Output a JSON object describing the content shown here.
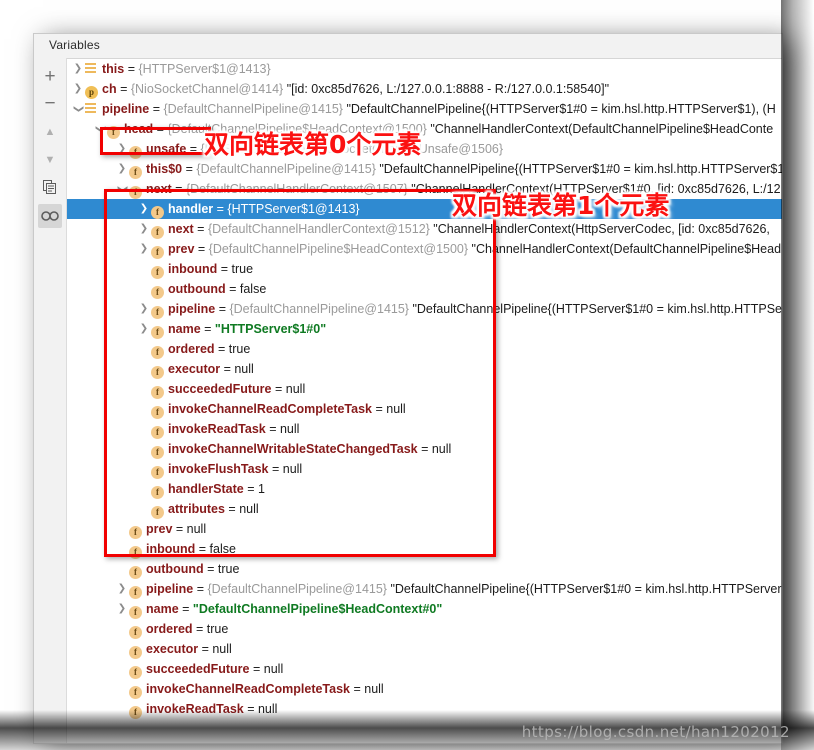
{
  "window": {
    "tool_window_title": "Variables"
  },
  "toolbar": {
    "buttons": [
      {
        "name": "add-watch-button",
        "icon": "plus-icon",
        "glyph": "+"
      },
      {
        "name": "remove-watch-button",
        "icon": "minus-icon",
        "glyph": "−"
      },
      {
        "name": "move-up-button",
        "icon": "arrow-up-icon",
        "glyph": "▲"
      },
      {
        "name": "move-down-button",
        "icon": "arrow-down-icon",
        "glyph": "▼"
      },
      {
        "name": "copy-value-button",
        "icon": "copy-icon",
        "glyph": "❐"
      },
      {
        "name": "toggle-watches-button",
        "icon": "glasses-icon",
        "glyph": "∞"
      }
    ]
  },
  "colors": {
    "selection_blue": "#2f8ad1",
    "annotation_red": "#f10000",
    "field_name": "#871a1a",
    "reference_gray": "#9a9a9a",
    "string_green": "#0f7a22",
    "panel_bg": "#ffffff",
    "header_bg": "#f2f2f2"
  },
  "annotations": [
    {
      "name": "annotation-head-element",
      "text": "双向链表第0个元素",
      "box_label": "head ="
    },
    {
      "name": "annotation-first-element",
      "text": "双向链表第1个元素",
      "box_label": "next context subtree"
    }
  ],
  "watermark": "https://blog.csdn.net/han1202012",
  "tree": {
    "rows": [
      {
        "indent": 0,
        "chev": "right",
        "icon": "bars",
        "name": "this",
        "eq": " = ",
        "ref": "{HTTPServer$1@1413}",
        "str": "",
        "selected": false
      },
      {
        "indent": 0,
        "chev": "right",
        "icon": "p",
        "name": "ch",
        "eq": " = ",
        "ref": "{NioSocketChannel@1414}",
        "str": "\"[id: 0xc85d7626, L:/127.0.0.1:8888 - R:/127.0.0.1:58540]\"",
        "selected": false
      },
      {
        "indent": 0,
        "chev": "down",
        "icon": "bars",
        "name": "pipeline",
        "eq": " = ",
        "ref": "{DefaultChannelPipeline@1415}",
        "str": "\"DefaultChannelPipeline{(HTTPServer$1#0 = kim.hsl.http.HTTPServer$1), (H",
        "selected": false
      },
      {
        "indent": 1,
        "chev": "down",
        "icon": "f",
        "name": "head",
        "eq": " = ",
        "ref": "{DefaultChannelPipeline$HeadContext@1500}",
        "str": "\"ChannelHandlerContext(DefaultChannelPipeline$HeadConte",
        "selected": false
      },
      {
        "indent": 2,
        "chev": "right",
        "icon": "f",
        "name": "unsafe",
        "eq": " = ",
        "ref": "{NioSocketChannel$NioSocketChannelUnsafe@1506}",
        "str": "",
        "selected": false
      },
      {
        "indent": 2,
        "chev": "right",
        "icon": "f",
        "name": "this$0",
        "eq": " = ",
        "ref": "{DefaultChannelPipeline@1415}",
        "str": "\"DefaultChannelPipeline{(HTTPServer$1#0 = kim.hsl.http.HTTPServer$1",
        "selected": false
      },
      {
        "indent": 2,
        "chev": "down",
        "icon": "f",
        "name": "next",
        "eq": " = ",
        "ref": "{DefaultChannelHandlerContext@1507}",
        "str": "\"ChannelHandlerContext(HTTPServer$1#0, [id: 0xc85d7626, L:/12",
        "selected": false
      },
      {
        "indent": 3,
        "chev": "right",
        "icon": "f",
        "name": "handler",
        "eq": " = ",
        "ref": "{HTTPServer$1@1413}",
        "str": "",
        "selected": true
      },
      {
        "indent": 3,
        "chev": "right",
        "icon": "f",
        "name": "next",
        "eq": " = ",
        "ref": "{DefaultChannelHandlerContext@1512}",
        "str": "\"ChannelHandlerContext(HttpServerCodec, [id: 0xc85d7626,",
        "selected": false
      },
      {
        "indent": 3,
        "chev": "right",
        "icon": "f",
        "name": "prev",
        "eq": " = ",
        "ref": "{DefaultChannelPipeline$HeadContext@1500}",
        "str": "\"ChannelHandlerContext(DefaultChannelPipeline$Head",
        "selected": false
      },
      {
        "indent": 3,
        "chev": "none",
        "icon": "f",
        "name": "inbound",
        "eq": " = ",
        "ref": "",
        "val": "true",
        "str": "",
        "selected": false
      },
      {
        "indent": 3,
        "chev": "none",
        "icon": "f",
        "name": "outbound",
        "eq": " = ",
        "ref": "",
        "val": "false",
        "str": "",
        "selected": false
      },
      {
        "indent": 3,
        "chev": "right",
        "icon": "f",
        "name": "pipeline",
        "eq": " = ",
        "ref": "{DefaultChannelPipeline@1415}",
        "str": "\"DefaultChannelPipeline{(HTTPServer$1#0 = kim.hsl.http.HTTPSe",
        "selected": false
      },
      {
        "indent": 3,
        "chev": "right",
        "icon": "f",
        "name": "name",
        "eq": " = ",
        "ref": "",
        "strv": "\"HTTPServer$1#0\"",
        "str": "",
        "selected": false
      },
      {
        "indent": 3,
        "chev": "none",
        "icon": "f",
        "name": "ordered",
        "eq": " = ",
        "ref": "",
        "val": "true",
        "str": "",
        "selected": false
      },
      {
        "indent": 3,
        "chev": "none",
        "icon": "f",
        "name": "executor",
        "eq": " = ",
        "ref": "",
        "val": "null",
        "str": "",
        "selected": false
      },
      {
        "indent": 3,
        "chev": "none",
        "icon": "f",
        "name": "succeededFuture",
        "eq": " = ",
        "ref": "",
        "val": "null",
        "str": "",
        "selected": false
      },
      {
        "indent": 3,
        "chev": "none",
        "icon": "f",
        "name": "invokeChannelReadCompleteTask",
        "eq": " = ",
        "ref": "",
        "val": "null",
        "str": "",
        "selected": false
      },
      {
        "indent": 3,
        "chev": "none",
        "icon": "f",
        "name": "invokeReadTask",
        "eq": " = ",
        "ref": "",
        "val": "null",
        "str": "",
        "selected": false
      },
      {
        "indent": 3,
        "chev": "none",
        "icon": "f",
        "name": "invokeChannelWritableStateChangedTask",
        "eq": " = ",
        "ref": "",
        "val": "null",
        "str": "",
        "selected": false
      },
      {
        "indent": 3,
        "chev": "none",
        "icon": "f",
        "name": "invokeFlushTask",
        "eq": " = ",
        "ref": "",
        "val": "null",
        "str": "",
        "selected": false
      },
      {
        "indent": 3,
        "chev": "none",
        "icon": "f",
        "name": "handlerState",
        "eq": " = ",
        "ref": "",
        "val": "1",
        "str": "",
        "selected": false
      },
      {
        "indent": 3,
        "chev": "none",
        "icon": "f",
        "name": "attributes",
        "eq": " = ",
        "ref": "",
        "val": "null",
        "str": "",
        "selected": false
      },
      {
        "indent": 2,
        "chev": "none",
        "icon": "f",
        "name": "prev",
        "eq": " = ",
        "ref": "",
        "val": "null",
        "str": "",
        "selected": false
      },
      {
        "indent": 2,
        "chev": "none",
        "icon": "f",
        "name": "inbound",
        "eq": " = ",
        "ref": "",
        "val": "false",
        "str": "",
        "selected": false
      },
      {
        "indent": 2,
        "chev": "none",
        "icon": "f",
        "name": "outbound",
        "eq": " = ",
        "ref": "",
        "val": "true",
        "str": "",
        "selected": false
      },
      {
        "indent": 2,
        "chev": "right",
        "icon": "f",
        "name": "pipeline",
        "eq": " = ",
        "ref": "{DefaultChannelPipeline@1415}",
        "str": "\"DefaultChannelPipeline{(HTTPServer$1#0 = kim.hsl.http.HTTPServer",
        "selected": false
      },
      {
        "indent": 2,
        "chev": "right",
        "icon": "f",
        "name": "name",
        "eq": " = ",
        "ref": "",
        "strv": "\"DefaultChannelPipeline$HeadContext#0\"",
        "str": "",
        "selected": false
      },
      {
        "indent": 2,
        "chev": "none",
        "icon": "f",
        "name": "ordered",
        "eq": " = ",
        "ref": "",
        "val": "true",
        "str": "",
        "selected": false
      },
      {
        "indent": 2,
        "chev": "none",
        "icon": "f",
        "name": "executor",
        "eq": " = ",
        "ref": "",
        "val": "null",
        "str": "",
        "selected": false
      },
      {
        "indent": 2,
        "chev": "none",
        "icon": "f",
        "name": "succeededFuture",
        "eq": " = ",
        "ref": "",
        "val": "null",
        "str": "",
        "selected": false
      },
      {
        "indent": 2,
        "chev": "none",
        "icon": "f",
        "name": "invokeChannelReadCompleteTask",
        "eq": " = ",
        "ref": "",
        "val": "null",
        "str": "",
        "selected": false
      },
      {
        "indent": 2,
        "chev": "none",
        "icon": "f",
        "name": "invokeReadTask",
        "eq": " = ",
        "ref": "",
        "val": "null",
        "str": "",
        "selected": false
      }
    ]
  }
}
